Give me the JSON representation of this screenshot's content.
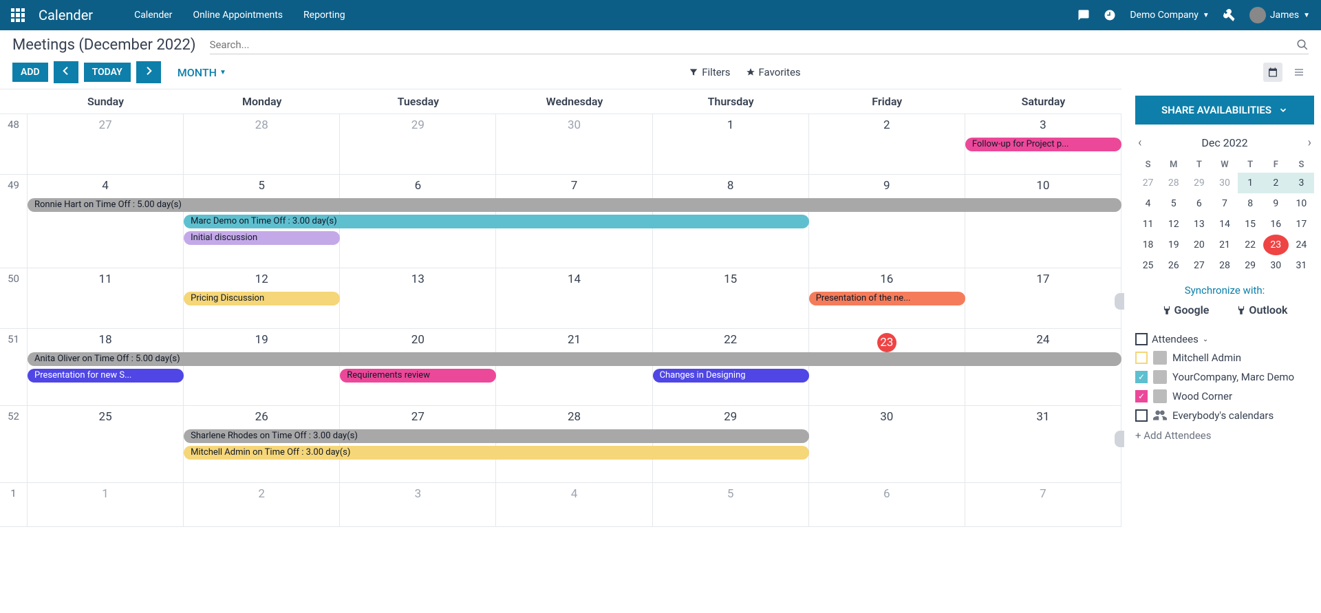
{
  "header": {
    "app_title": "Calender",
    "nav": [
      "Calender",
      "Online Appointments",
      "Reporting"
    ],
    "company": "Demo Company",
    "user": "James"
  },
  "page": {
    "title": "Meetings (December 2022)",
    "search_placeholder": "Search..."
  },
  "toolbar": {
    "add": "ADD",
    "today": "TODAY",
    "view": "MONTH",
    "filters": "Filters",
    "favorites": "Favorites"
  },
  "calendar": {
    "day_headers": [
      "Sunday",
      "Monday",
      "Tuesday",
      "Wednesday",
      "Thursday",
      "Friday",
      "Saturday"
    ],
    "weeks": [
      {
        "num": "48",
        "days": [
          "27",
          "28",
          "29",
          "30",
          "1",
          "2",
          "3"
        ],
        "other_start": 4,
        "events": [
          {
            "text": "Follow-up for Project p...",
            "color": "#ec4899",
            "col": 6,
            "span": 1,
            "row": 0
          }
        ]
      },
      {
        "num": "49",
        "days": [
          "4",
          "5",
          "6",
          "7",
          "8",
          "9",
          "10"
        ],
        "events": [
          {
            "text": "Ronnie Hart on Time Off : 5.00 day(s)",
            "color": "#a8a8a8",
            "col": 0,
            "span": 7,
            "row": 0
          },
          {
            "text": "Marc Demo on Time Off : 3.00 day(s)",
            "color": "#5ebfcf",
            "col": 1,
            "span": 4,
            "row": 1
          },
          {
            "text": "Initial discussion",
            "color": "#c4a9e8",
            "col": 1,
            "span": 1,
            "row": 2
          }
        ]
      },
      {
        "num": "50",
        "days": [
          "11",
          "12",
          "13",
          "14",
          "15",
          "16",
          "17"
        ],
        "marker": true,
        "events": [
          {
            "text": "Pricing Discussion",
            "color": "#f5d678",
            "col": 1,
            "span": 1,
            "row": 0
          },
          {
            "text": "Presentation of the ne...",
            "color": "#f57c5a",
            "col": 5,
            "span": 1,
            "row": 0
          }
        ]
      },
      {
        "num": "51",
        "days": [
          "18",
          "19",
          "20",
          "21",
          "22",
          "23",
          "24"
        ],
        "today_idx": 5,
        "events": [
          {
            "text": "Anita Oliver on Time Off : 5.00 day(s)",
            "color": "#a8a8a8",
            "col": 0,
            "span": 7,
            "row": 0
          },
          {
            "text": "Presentation for new S...",
            "color": "#4f46e5",
            "tcolor": "#fff",
            "col": 0,
            "span": 1,
            "row": 1
          },
          {
            "text": "Requirements review",
            "color": "#ec4899",
            "col": 2,
            "span": 1,
            "row": 1
          },
          {
            "text": "Changes in Designing",
            "color": "#4f46e5",
            "tcolor": "#fff",
            "col": 4,
            "span": 1,
            "row": 1
          }
        ]
      },
      {
        "num": "52",
        "days": [
          "25",
          "26",
          "27",
          "28",
          "29",
          "30",
          "31"
        ],
        "marker": true,
        "events": [
          {
            "text": "Sharlene Rhodes on Time Off : 3.00 day(s)",
            "color": "#a8a8a8",
            "col": 1,
            "span": 4,
            "row": 0
          },
          {
            "text": "Mitchell Admin on Time Off : 3.00 day(s)",
            "color": "#f5d678",
            "col": 1,
            "span": 4,
            "row": 1
          }
        ]
      },
      {
        "num": "1",
        "days": [
          "1",
          "2",
          "3",
          "4",
          "5",
          "6",
          "7"
        ],
        "other_start": 0,
        "events": []
      }
    ]
  },
  "sidebar": {
    "share": "SHARE AVAILABILITIES",
    "month_label": "Dec 2022",
    "mini_head": [
      "S",
      "M",
      "T",
      "W",
      "T",
      "F",
      "S"
    ],
    "mini_rows": [
      {
        "days": [
          "27",
          "28",
          "29",
          "30",
          "1",
          "2",
          "3"
        ],
        "other_to": 3,
        "hl_from": 4
      },
      {
        "days": [
          "4",
          "5",
          "6",
          "7",
          "8",
          "9",
          "10"
        ]
      },
      {
        "days": [
          "11",
          "12",
          "13",
          "14",
          "15",
          "16",
          "17"
        ]
      },
      {
        "days": [
          "18",
          "19",
          "20",
          "21",
          "22",
          "23",
          "24"
        ],
        "today_idx": 5
      },
      {
        "days": [
          "25",
          "26",
          "27",
          "28",
          "29",
          "30",
          "31"
        ]
      }
    ],
    "sync_label": "Synchronize with:",
    "sync_google": "Google",
    "sync_outlook": "Outlook",
    "attendees_label": "Attendees",
    "attendees": [
      {
        "name": "Mitchell Admin",
        "checked": false,
        "color": "#f5d678"
      },
      {
        "name": "YourCompany, Marc Demo",
        "checked": true,
        "color": "#5ebfcf"
      },
      {
        "name": "Wood Corner",
        "checked": true,
        "color": "#ec4899"
      },
      {
        "name": "Everybody's calendars",
        "checked": false,
        "color": "#374151",
        "group": true
      }
    ],
    "add_attendees": "+ Add Attendees"
  }
}
